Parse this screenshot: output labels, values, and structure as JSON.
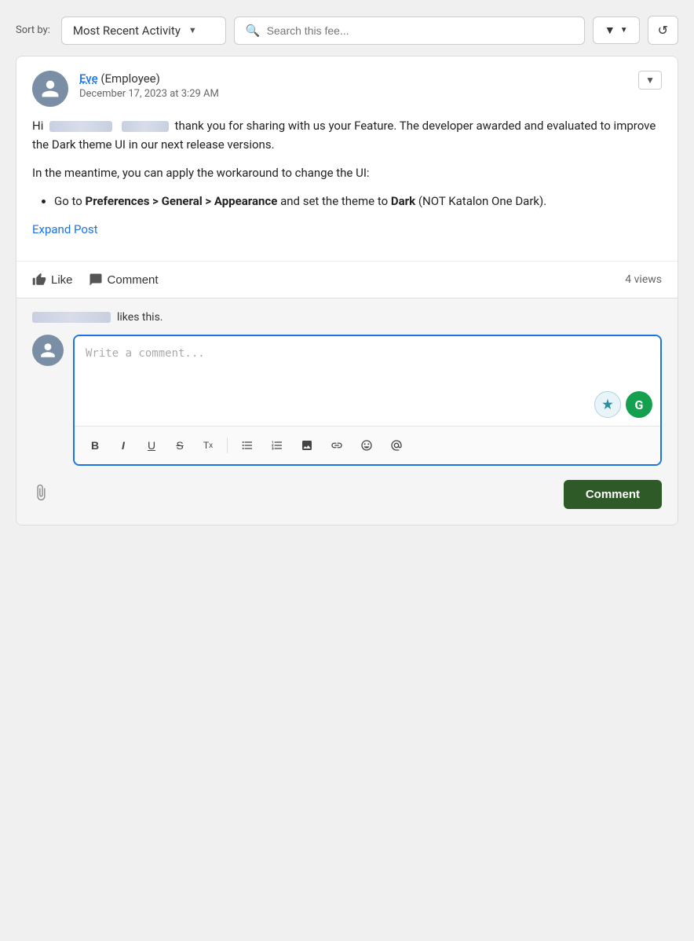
{
  "topbar": {
    "sort_label": "Sort by:",
    "sort_value": "Most Recent Activity",
    "search_placeholder": "Search this fee...",
    "filter_label": "▼",
    "refresh_label": "↺"
  },
  "post": {
    "author_name": "Eve",
    "author_role": " (Employee)",
    "date": "December 17, 2023 at 3:29 AM",
    "body_line1": " thank you for sharing with us your Feature. The developer awarded and evaluated to improve the Dark theme UI in our next release versions.",
    "body_line2": "In the meantime, you can apply the workaround to change the UI:",
    "bullet1_prefix": "Go to ",
    "bullet1_bold": "Preferences > General > Appearance",
    "bullet1_mid": " and set the theme to ",
    "bullet1_bold2": "Dark",
    "bullet1_end": " (NOT Katalon One Dark).",
    "expand_label": "Expand Post",
    "like_label": "Like",
    "comment_label": "Comment",
    "views_label": "4 views",
    "likes_suffix": "likes this.",
    "comment_placeholder": "Write a comment...",
    "toolbar": {
      "bold": "B",
      "italic": "I",
      "underline": "U",
      "strikethrough": "S",
      "clear_format": "Tx",
      "bullet_list": "≡",
      "ordered_list": "≣",
      "image": "🖼",
      "link": "🔗",
      "emoji": "☺",
      "mention": "👤"
    },
    "comment_btn": "Comment"
  }
}
